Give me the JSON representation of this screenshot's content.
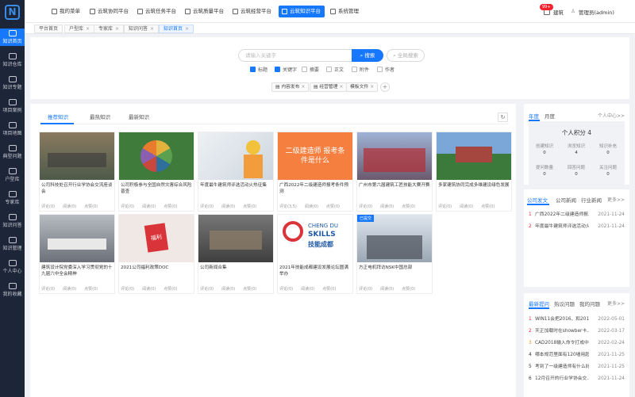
{
  "sidebar": {
    "items": [
      {
        "label": "知识首页",
        "active": true
      },
      {
        "label": "知识仓库"
      },
      {
        "label": "知识专题"
      },
      {
        "label": "项目案例"
      },
      {
        "label": "项目地图"
      },
      {
        "label": "典型问题"
      },
      {
        "label": "户型库"
      },
      {
        "label": "专家库"
      },
      {
        "label": "知识问答"
      },
      {
        "label": "知识管理"
      },
      {
        "label": "个人中心"
      },
      {
        "label": "我的收藏"
      }
    ]
  },
  "topnav": {
    "items": [
      {
        "label": "我的菜单"
      },
      {
        "label": "云筑协同平台"
      },
      {
        "label": "云筑任务平台"
      },
      {
        "label": "云筑质量平台"
      },
      {
        "label": "云筑经营平台"
      },
      {
        "label": "云筑知识平台",
        "active": true
      },
      {
        "label": "系统管理"
      }
    ],
    "badge": "99+",
    "link": "建筑",
    "user": "管理员(admin)"
  },
  "pagetabs": [
    {
      "label": "平台首页"
    },
    {
      "label": "户型库",
      "close": "×"
    },
    {
      "label": "专家库",
      "close": "×"
    },
    {
      "label": "知识问答",
      "close": "×"
    },
    {
      "label": "知识首页",
      "close": "×",
      "active": true
    }
  ],
  "search": {
    "placeholder": "请输入关键字",
    "button": "搜索",
    "all_button": "全局搜索",
    "filters": [
      {
        "label": "标题",
        "checked": true
      },
      {
        "label": "关键字",
        "checked": true
      },
      {
        "label": "摘要",
        "checked": false
      },
      {
        "label": "正文",
        "checked": false
      },
      {
        "label": "附件",
        "checked": false
      },
      {
        "label": "作者",
        "checked": false
      }
    ],
    "chips": [
      "内容发布",
      "经营管理",
      "模板文件"
    ]
  },
  "main": {
    "tabs": [
      {
        "label": "推荐知识",
        "active": true
      },
      {
        "label": "最热知识"
      },
      {
        "label": "最新知识"
      }
    ],
    "refresh_icon": "↻",
    "cards": [
      {
        "title": "公司科技处召开行业学协会交流座谈会",
        "meta": "评论(0)　　阅读(0)　　点赞(0)",
        "color": "#5f6a55"
      },
      {
        "title": "公司积极参与全国自然灾害综合风险普查",
        "meta": "评论(0)　　阅读(0)　　点赞(0)",
        "color": "#4e7d47"
      },
      {
        "title": "年度最牛建筑师评选活动火热征集",
        "meta": "评论(0)　　阅读(0)　　点赞(0)",
        "color": "#d8dee6"
      },
      {
        "title": "广西2022年二级建造师报考条件预测",
        "meta": "评论(3.5)　　阅读(0)　　点赞(0)",
        "color": "#f47f3f"
      },
      {
        "title": "广州市第六届建筑工匠技能大赛开赛",
        "meta": "评论(0)　　阅读(0)　　点赞(0)",
        "color": "#7b6a78"
      },
      {
        "title": "多家建筑协同完成多维建设绿色发展",
        "meta": "评论(0)　　阅读(0)　　点赞(0)",
        "color": "#6f8fba"
      },
      {
        "title": "建筑设计院党委深入学习贯彻党的十九届六中全会精神",
        "meta": "评论(0)　　阅读(0)　　点赞(0)",
        "color": "#8a8d92"
      },
      {
        "title": "2021公司福利政策DOC",
        "meta": "评论(0)　　阅读(0)　　点赞(0)",
        "color": "#e9e4e0"
      },
      {
        "title": "公司新闻合集",
        "meta": "评论(0)　　阅读(0)　　点赞(0)",
        "color": "#5a5a5a"
      },
      {
        "title": "2021年技能成都建设发展论坛圆满举办",
        "meta": "评论(0)　　阅读(0)　　点赞(0)",
        "color": "#ffffff"
      },
      {
        "title": "方正电机拜访NSK中国总部",
        "meta": "评论(0)　　阅读(0)　　点赞(0)",
        "color": "#c9d3dd",
        "tag": "已提交"
      }
    ],
    "img_text": {
      "card4": "二级建造师 报考条件是什么",
      "card10a": "CHENG DU",
      "card10b": "SKILLS",
      "card10c": "技能成都",
      "card8": "福利"
    }
  },
  "score": {
    "tabs": [
      {
        "label": "年度",
        "active": true
      },
      {
        "label": "月度"
      }
    ],
    "more": "个人中心>>",
    "title": "个人积分 4",
    "items": [
      {
        "label": "创建知识",
        "value": "0"
      },
      {
        "label": "浏览知识",
        "value": "4"
      },
      {
        "label": "知识补充",
        "value": "0"
      },
      {
        "label": "提问数量",
        "value": "0"
      },
      {
        "label": "回答问题",
        "value": "0"
      },
      {
        "label": "关注问题",
        "value": "0"
      }
    ]
  },
  "news": {
    "tabs": [
      {
        "label": "公司发文",
        "active": true
      },
      {
        "label": "公司新闻"
      },
      {
        "label": "行业新闻"
      }
    ],
    "more": "更多>>",
    "rows": [
      {
        "n": "1",
        "title": "广西2022年二级建造师报...",
        "date": "2021-11-24"
      },
      {
        "n": "2",
        "title": "年度最牛建筑师评选活动火...",
        "date": "2021-11-24"
      }
    ]
  },
  "qa": {
    "tabs": [
      {
        "label": "最新提问",
        "active": true
      },
      {
        "label": "热议问题"
      },
      {
        "label": "我的问题"
      }
    ],
    "more": "更多>>",
    "rows": [
      {
        "n": "1",
        "title": "WIN11会把2016、和2014...",
        "date": "2022-05-01"
      },
      {
        "n": "2",
        "title": "天正加载时在showber卡...",
        "date": "2022-03-17"
      },
      {
        "n": "3",
        "title": "CAD2018输入命令打成中...",
        "date": "2022-02-24"
      },
      {
        "n": "4",
        "title": "哪本规范里面有120墙用超...",
        "date": "2021-11-25"
      },
      {
        "n": "5",
        "title": "考到了一级建造师有什么好...",
        "date": "2021-11-25"
      },
      {
        "n": "6",
        "title": "12月召开的行业学协会交...",
        "date": "2021-11-24"
      }
    ]
  }
}
